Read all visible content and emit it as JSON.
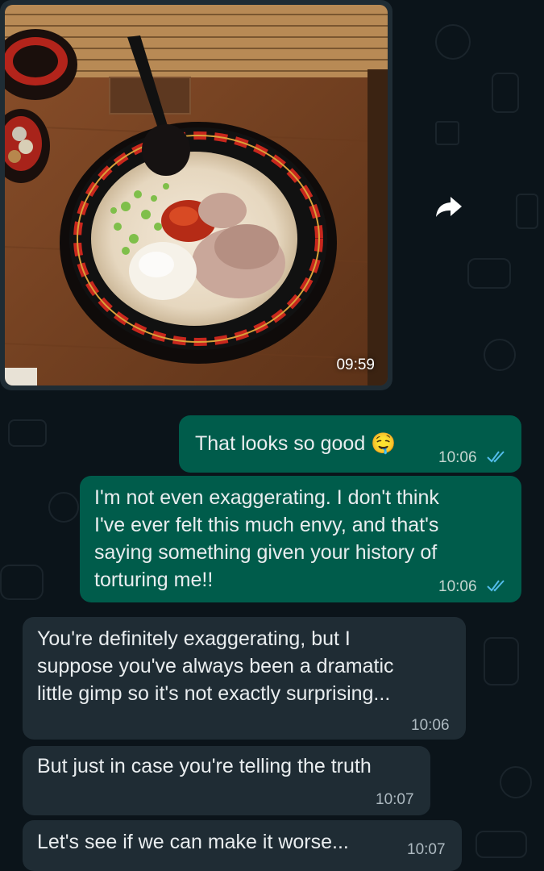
{
  "chat": {
    "image_message": {
      "time": "09:59",
      "icon": "forward-icon"
    },
    "messages": [
      {
        "direction": "out",
        "text": "That looks so good 🤤",
        "time": "10:06",
        "status": "read"
      },
      {
        "direction": "out",
        "lines": [
          "I'm not even exaggerating. I don't think",
          "I've ever felt this much envy, and that's",
          "saying something given your history of",
          "torturing me!!"
        ],
        "time": "10:06",
        "status": "read"
      },
      {
        "direction": "in",
        "lines": [
          "You're definitely exaggerating, but I",
          "suppose you've always been a dramatic",
          "little gimp so it's not exactly surprising..."
        ],
        "time": "10:06"
      },
      {
        "direction": "in",
        "text": "But just in case you're telling the truth",
        "time": "10:07"
      },
      {
        "direction": "in",
        "text": "Let's see if we can make it worse...",
        "time": "10:07"
      }
    ]
  },
  "colors": {
    "background": "#0b141a",
    "incoming_bubble": "#1f2c34",
    "outgoing_bubble": "#005c4b",
    "read_ticks": "#53bdeb"
  }
}
